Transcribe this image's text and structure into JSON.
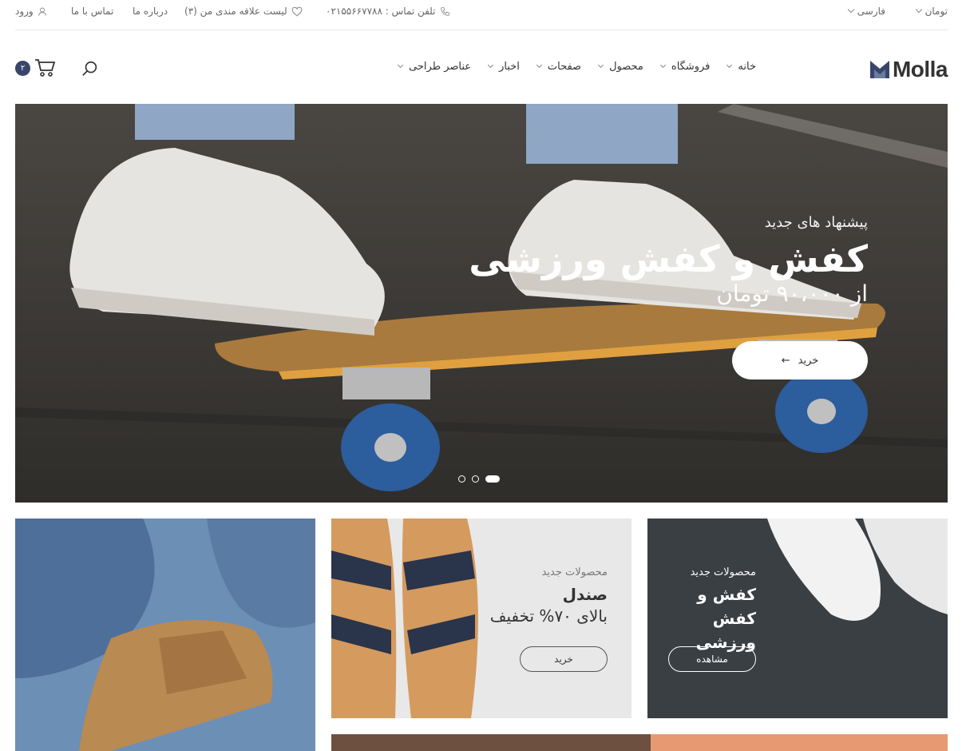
{
  "topbar": {
    "currency": "تومان",
    "language": "فارسی",
    "phone": "تلفن تماس : ۰۲۱۵۵۶۶۷۷۸۸",
    "wishlist": "لیست علاقه مندی من (۳)",
    "about": "درباره ما",
    "contact": "تماس با ما",
    "login": "ورود"
  },
  "header": {
    "logo": "Molla",
    "nav": [
      "خانه",
      "فروشگاه",
      "محصول",
      "صفحات",
      "اخبار",
      "عناصر طراحی"
    ],
    "cart_count": "۲"
  },
  "hero": {
    "subtitle": "پیشنهاد های جدید",
    "title": "کفش و کفش ورزشی",
    "price": "از ۹۰،۰۰۰ تومان",
    "button": "خرید",
    "slides": 3,
    "active_slide": 3
  },
  "banners": {
    "b1": {
      "sub": "محصولات جدید",
      "title_line1": "کفش و",
      "title_line2": "کفش ورزشی",
      "button": "مشاهده"
    },
    "b2": {
      "sub": "محصولات جدید",
      "title": "صندل",
      "discount": "بالای ۷۰% تخفیف",
      "button": "خرید"
    }
  },
  "colors": {
    "accent": "#39466a",
    "hero_bg": "#3e3b37",
    "strip": "#ea9a75"
  }
}
